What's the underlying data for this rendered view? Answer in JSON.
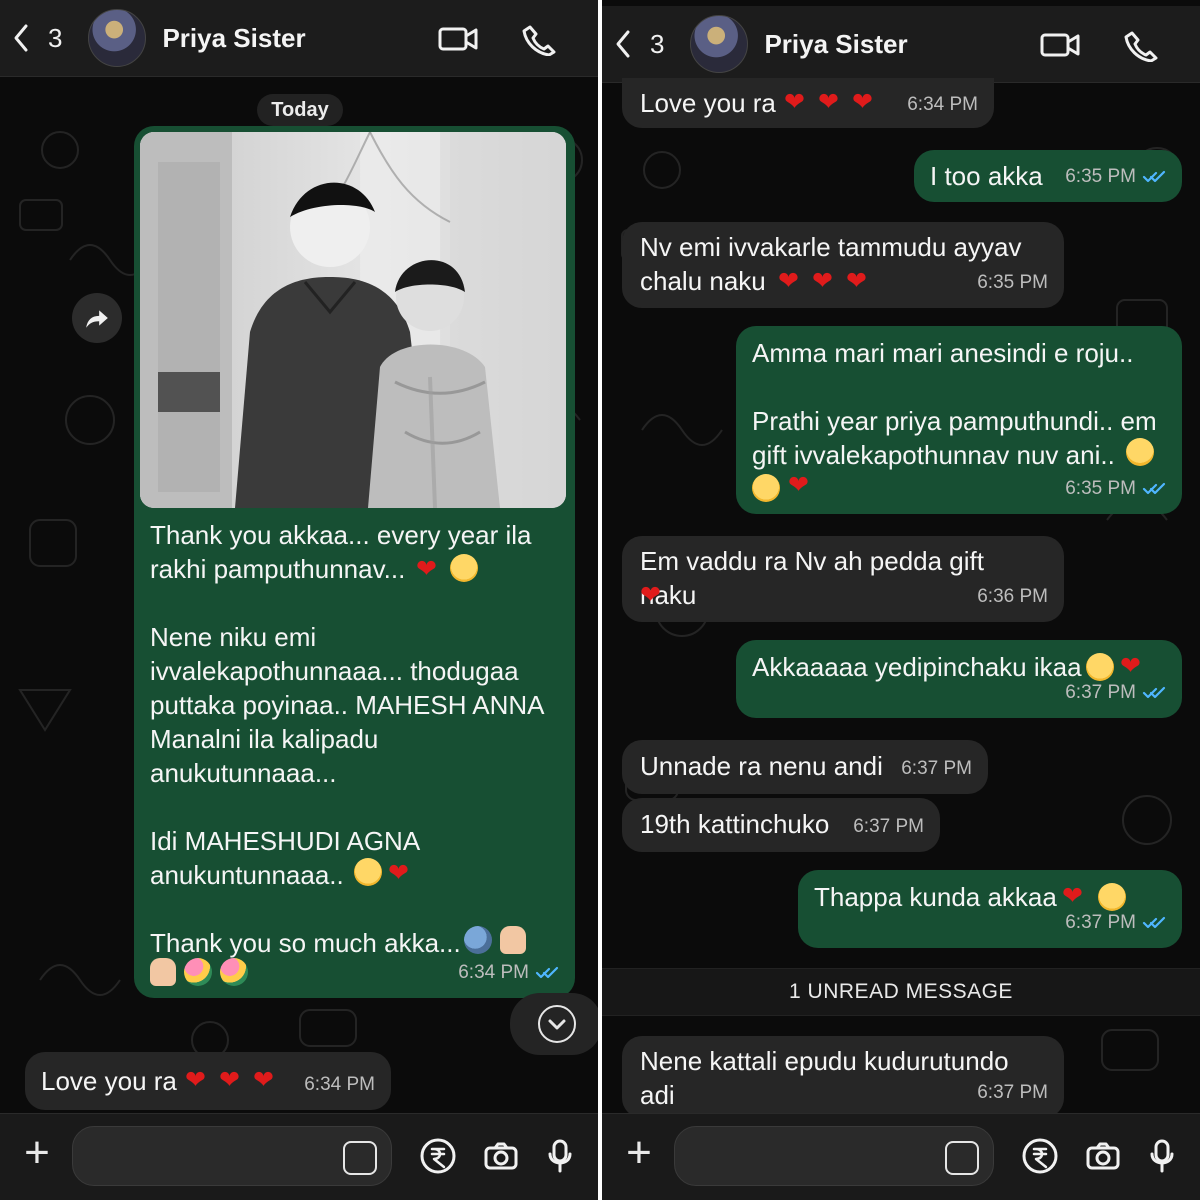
{
  "left": {
    "header": {
      "back_count": "3",
      "contact_name": "Priya Sister"
    },
    "day_label": "Today",
    "messages": {
      "m1": {
        "text": "Thank you akkaa... every year ila rakhi pamputhunnav...\n\nNene niku emi ivvalekapothunnaaa... thodugaa puttaka poyinaa.. MAHESH ANNA Manalni ila kalipadu anukutunnaaa...\n\nIdi MAHESHUDI AGNA anukuntunnaaa..\n\nThank you so much akka...",
        "time": "6:34 PM"
      },
      "m2": {
        "text": "Love you ra",
        "time": "6:34 PM"
      }
    }
  },
  "right": {
    "header": {
      "back_count": "3",
      "contact_name": "Priya Sister"
    },
    "messages": {
      "r1": {
        "text": "Love you ra",
        "time": "6:34 PM"
      },
      "r2": {
        "text": "I too akka",
        "time": "6:35 PM"
      },
      "r3": {
        "text": "Nv emi ivvakarle tammudu ayyav\nchalu naku",
        "time": "6:35 PM"
      },
      "r4": {
        "text": "Amma mari mari anesindi e roju..\n\nPrathi year priya pamputhundi.. em\ngift ivvalekapothunnav nuv ani..",
        "time": "6:35 PM"
      },
      "r5": {
        "text": "Em vaddu ra Nv ah pedda gift naku",
        "time": "6:36 PM"
      },
      "r6": {
        "text": "Akkaaaaa yedipinchaku ikaa",
        "time": "6:37 PM"
      },
      "r7": {
        "text": "Unnade ra nenu andi",
        "time": "6:37 PM"
      },
      "r8": {
        "text": "19th kattinchuko",
        "time": "6:37 PM"
      },
      "r9": {
        "text": "Thappa kunda akkaa",
        "time": "6:37 PM"
      },
      "r10": {
        "text": "Nene kattali epudu kudurutundo\nadi",
        "time": "6:37 PM"
      }
    },
    "unread_label": "1 UNREAD MESSAGE"
  },
  "colors": {
    "background": "#0b0b0b",
    "outgoing_bubble": "#174f33",
    "incoming_bubble": "#262626",
    "read_ticks": "#4fb6ff",
    "heart": "#e01b1b"
  },
  "icons": [
    "back-chevron-icon",
    "video-camera-icon",
    "phone-icon",
    "forward-arrow-icon",
    "scroll-down-chevron-icon",
    "plus-icon",
    "sticker-icon",
    "rupee-payment-icon",
    "camera-icon",
    "microphone-icon",
    "double-check-icon",
    "heart-icon",
    "pleading-face-icon",
    "crying-face-icon",
    "pray-icon",
    "flower-bouquet-icon",
    "people-icon"
  ]
}
